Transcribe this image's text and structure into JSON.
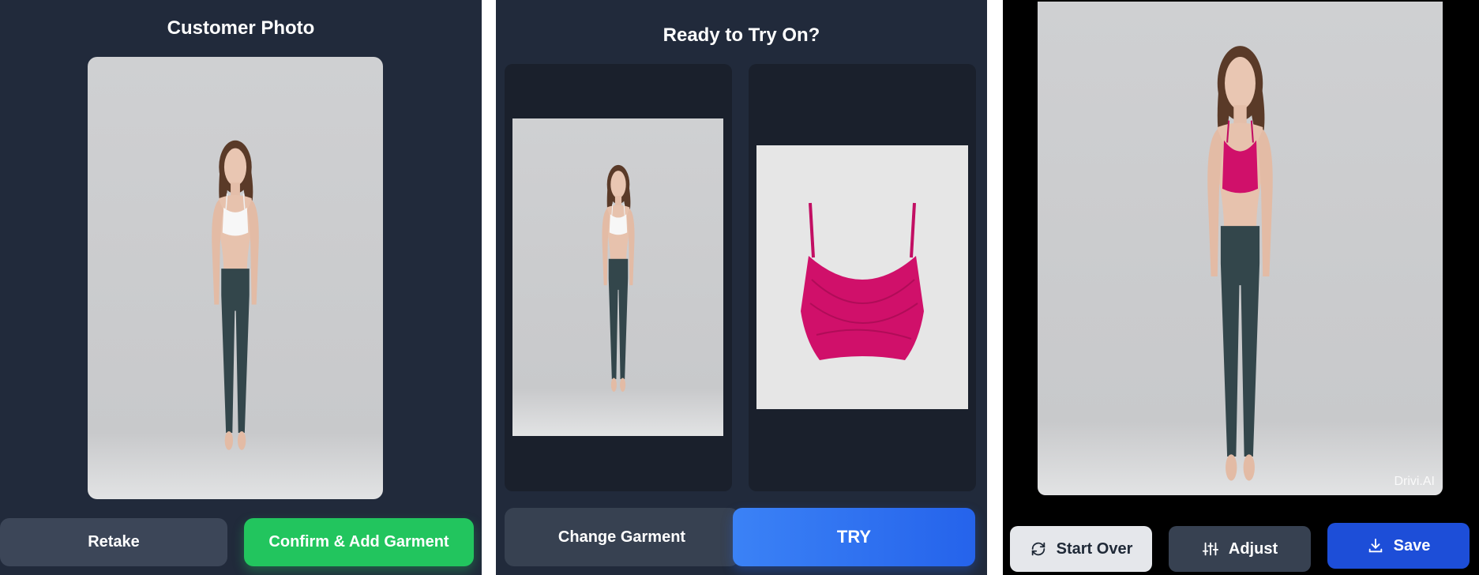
{
  "customer_panel": {
    "title": "Customer Photo",
    "retake_label": "Retake",
    "confirm_label": "Confirm & Add Garment"
  },
  "tryon_panel": {
    "title": "Ready to Try On?",
    "change_label": "Change Garment",
    "try_label": "TRY"
  },
  "result_panel": {
    "watermark": "Drivi.AI",
    "start_over_label": "Start Over",
    "adjust_label": "Adjust",
    "save_label": "Save"
  },
  "colors": {
    "panel_bg": "#212a3b",
    "confirm_green": "#22c55e",
    "try_blue": "#2563eb",
    "garment_pink": "#d0106a"
  },
  "icons": [
    "refresh-icon",
    "sliders-icon",
    "download-icon"
  ]
}
